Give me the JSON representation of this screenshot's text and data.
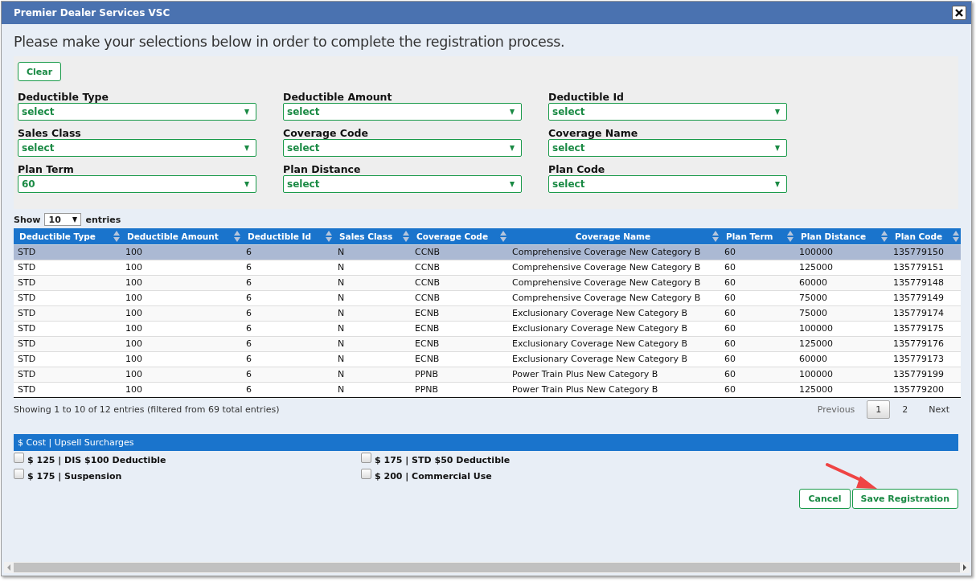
{
  "window": {
    "title": "Premier Dealer Services VSC"
  },
  "instruction": "Please make your selections below in order to complete the registration process.",
  "clear_button": "Clear",
  "filters": [
    {
      "label": "Deductible Type",
      "value": "select"
    },
    {
      "label": "Deductible Amount",
      "value": "select"
    },
    {
      "label": "Deductible Id",
      "value": "select"
    },
    {
      "label": "Sales Class",
      "value": "select"
    },
    {
      "label": "Coverage Code",
      "value": "select"
    },
    {
      "label": "Coverage Name",
      "value": "select"
    },
    {
      "label": "Plan Term",
      "value": "60"
    },
    {
      "label": "Plan Distance",
      "value": "select"
    },
    {
      "label": "Plan Code",
      "value": "select"
    }
  ],
  "length_menu": {
    "prefix": "Show",
    "value": "10",
    "suffix": "entries"
  },
  "table": {
    "columns": [
      "Deductible Type",
      "Deductible Amount",
      "Deductible Id",
      "Sales Class",
      "Coverage Code",
      "Coverage Name",
      "Plan Term",
      "Plan Distance",
      "Plan Code"
    ],
    "rows": [
      {
        "selected": true,
        "cells": [
          "STD",
          "100",
          "6",
          "N",
          "CCNB",
          "Comprehensive Coverage New Category B",
          "60",
          "100000",
          "135779150"
        ]
      },
      {
        "selected": false,
        "cells": [
          "STD",
          "100",
          "6",
          "N",
          "CCNB",
          "Comprehensive Coverage New Category B",
          "60",
          "125000",
          "135779151"
        ]
      },
      {
        "selected": false,
        "cells": [
          "STD",
          "100",
          "6",
          "N",
          "CCNB",
          "Comprehensive Coverage New Category B",
          "60",
          "60000",
          "135779148"
        ]
      },
      {
        "selected": false,
        "cells": [
          "STD",
          "100",
          "6",
          "N",
          "CCNB",
          "Comprehensive Coverage New Category B",
          "60",
          "75000",
          "135779149"
        ]
      },
      {
        "selected": false,
        "cells": [
          "STD",
          "100",
          "6",
          "N",
          "ECNB",
          "Exclusionary Coverage New Category B",
          "60",
          "75000",
          "135779174"
        ]
      },
      {
        "selected": false,
        "cells": [
          "STD",
          "100",
          "6",
          "N",
          "ECNB",
          "Exclusionary Coverage New Category B",
          "60",
          "100000",
          "135779175"
        ]
      },
      {
        "selected": false,
        "cells": [
          "STD",
          "100",
          "6",
          "N",
          "ECNB",
          "Exclusionary Coverage New Category B",
          "60",
          "125000",
          "135779176"
        ]
      },
      {
        "selected": false,
        "cells": [
          "STD",
          "100",
          "6",
          "N",
          "ECNB",
          "Exclusionary Coverage New Category B",
          "60",
          "60000",
          "135779173"
        ]
      },
      {
        "selected": false,
        "cells": [
          "STD",
          "100",
          "6",
          "N",
          "PPNB",
          "Power Train Plus New Category B",
          "60",
          "100000",
          "135779199"
        ]
      },
      {
        "selected": false,
        "cells": [
          "STD",
          "100",
          "6",
          "N",
          "PPNB",
          "Power Train Plus New Category B",
          "60",
          "125000",
          "135779200"
        ]
      }
    ]
  },
  "info": "Showing 1 to 10 of 12 entries (filtered from 69 total entries)",
  "pagination": {
    "previous": "Previous",
    "pages": [
      {
        "label": "1",
        "selected": true
      },
      {
        "label": "2",
        "selected": false
      }
    ],
    "next": "Next"
  },
  "surcharges": {
    "title": "$ Cost | Upsell Surcharges",
    "options": [
      {
        "label": "$ 125 | DIS $100 Deductible",
        "checked": false
      },
      {
        "label": "$ 175 | STD $50 Deductible",
        "checked": false
      },
      {
        "label": "$ 175 | Suspension",
        "checked": false
      },
      {
        "label": "$ 200 | Commercial Use",
        "checked": false
      }
    ]
  },
  "buttons": [
    "Cancel",
    "Save Registration"
  ]
}
